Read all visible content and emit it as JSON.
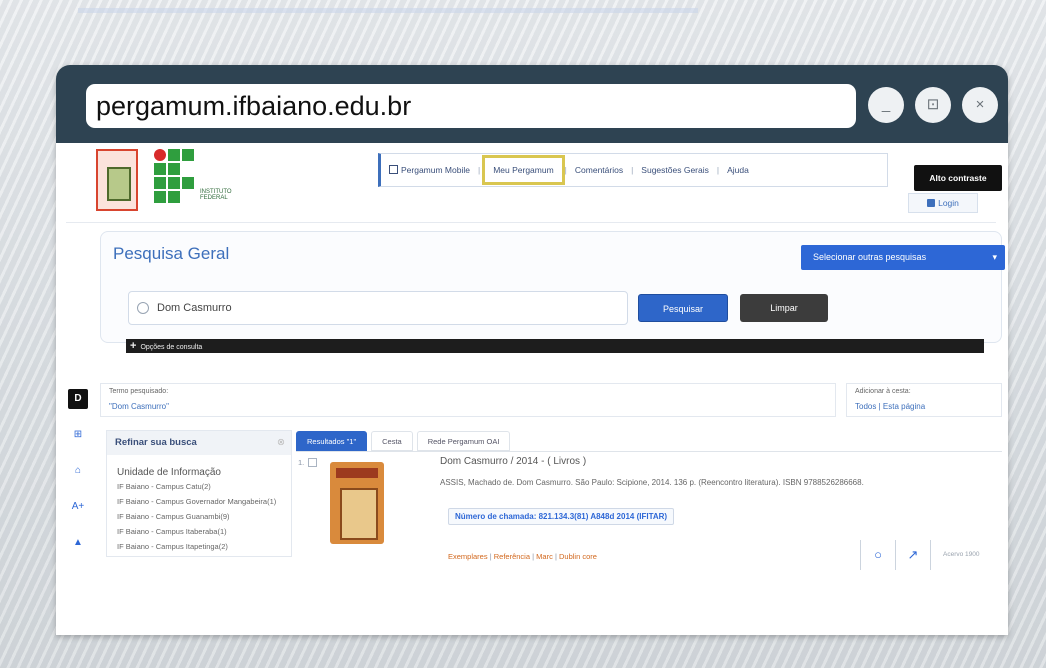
{
  "browser": {
    "url": "pergamum.ifbaiano.edu.br",
    "min_glyph": "_",
    "max_glyph": "⊡",
    "close_glyph": "×"
  },
  "logo": {
    "subtitle": "INSTITUTO FEDERAL"
  },
  "nav": {
    "items": [
      "Pergamum Mobile",
      "Meu Pergamum",
      "Comentários",
      "Sugestões Gerais",
      "Ajuda"
    ],
    "active_index": 1
  },
  "header": {
    "alto_contraste": "Alto contraste",
    "login": "Login"
  },
  "search": {
    "title": "Pesquisa Geral",
    "select_other": "Selecionar outras pesquisas",
    "caret": "▾",
    "query": "Dom Casmurro",
    "search_button": "Pesquisar",
    "clear_button": "Limpar",
    "options_label": "Opções de consulta",
    "options_plus": "+"
  },
  "term": {
    "label": "Termo pesquisado:",
    "value": "\"Dom Casmurro\""
  },
  "basket": {
    "label": "Adicionar à cesta:",
    "all": "Todos",
    "sep": "|",
    "this_page": "Esta página"
  },
  "side_tools": [
    "D",
    "⊞",
    "⌂",
    "A+",
    "▲"
  ],
  "refine": {
    "title": "Refinar sua busca",
    "close": "⊗",
    "unit_title": "Unidade de Informação",
    "units": [
      "IF Baiano - Campus Catu(2)",
      "IF Baiano - Campus Governador Mangabeira(1)",
      "IF Baiano - Campus Guanambi(9)",
      "IF Baiano - Campus Itaberaba(1)",
      "IF Baiano - Campus Itapetinga(2)"
    ]
  },
  "tabs": {
    "results": "Resultados \"1\"",
    "cesta": "Cesta",
    "oai": "Rede Pergamum OAI"
  },
  "result": {
    "number": "1.",
    "title": "Dom Casmurro / 2014 - ( Livros )",
    "description": "ASSIS, Machado de. Dom Casmurro. São Paulo: Scipione, 2014. 136 p. (Reencontro literatura). ISBN 9788526286668.",
    "call_number": "Número de chamada: 821.134.3(81) A848d 2014 (IFITAR)",
    "links": [
      "Exemplares",
      "Referência",
      "Marc",
      "Dublin core"
    ],
    "acervo": "Acervo 1900"
  }
}
